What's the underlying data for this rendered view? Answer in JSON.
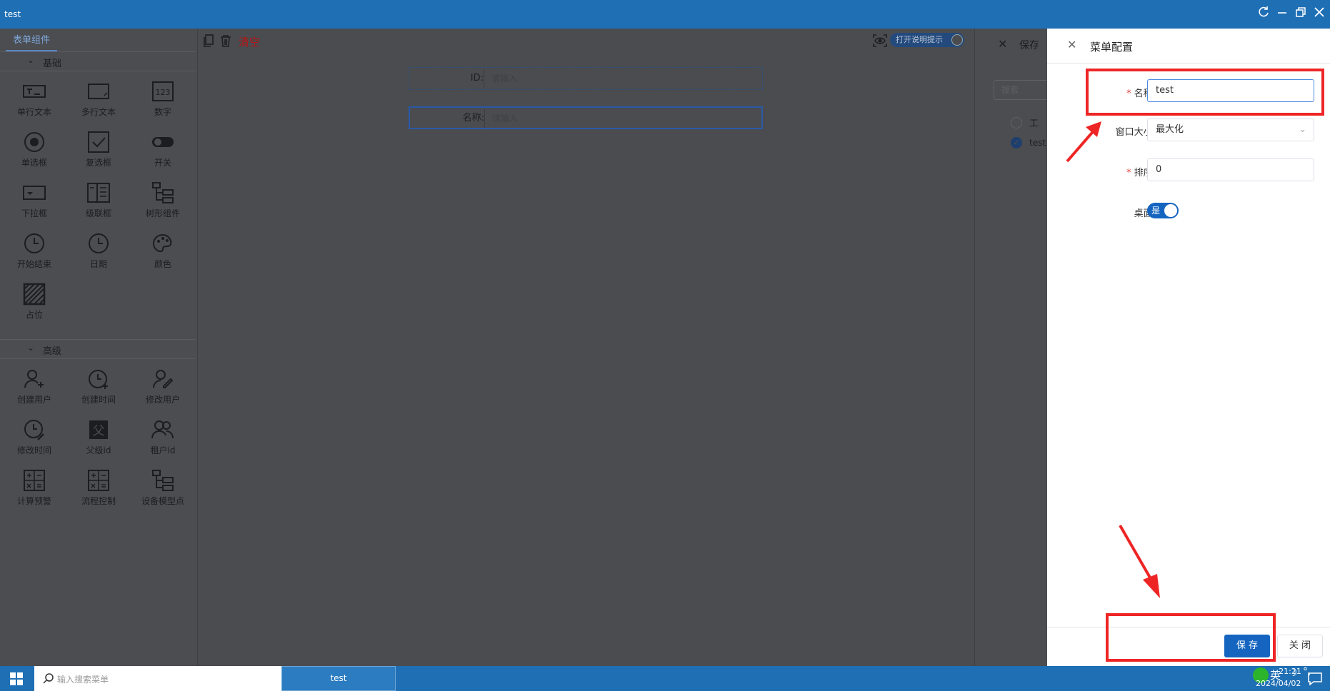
{
  "window": {
    "title": "test"
  },
  "left_panel": {
    "tab_label": "表单组件",
    "basic": {
      "header": "基础",
      "items": [
        {
          "label": "单行文本",
          "icon": "single-line-text-icon"
        },
        {
          "label": "多行文本",
          "icon": "multi-line-text-icon"
        },
        {
          "label": "数字",
          "icon": "number-icon"
        },
        {
          "label": "单选框",
          "icon": "radio-icon"
        },
        {
          "label": "复选框",
          "icon": "checkbox-icon"
        },
        {
          "label": "开关",
          "icon": "switch-icon"
        },
        {
          "label": "下拉框",
          "icon": "dropdown-icon"
        },
        {
          "label": "级联框",
          "icon": "cascader-icon"
        },
        {
          "label": "树形组件",
          "icon": "tree-icon"
        },
        {
          "label": "开始结束",
          "icon": "clock-range-icon"
        },
        {
          "label": "日期",
          "icon": "date-clock-icon"
        },
        {
          "label": "颜色",
          "icon": "palette-icon"
        },
        {
          "label": "占位",
          "icon": "placeholder-icon"
        }
      ]
    },
    "advanced": {
      "header": "高级",
      "items": [
        {
          "label": "创建用户",
          "icon": "create-user-icon"
        },
        {
          "label": "创建时间",
          "icon": "create-time-icon"
        },
        {
          "label": "修改用户",
          "icon": "edit-user-icon"
        },
        {
          "label": "修改时间",
          "icon": "edit-time-icon"
        },
        {
          "label": "父级id",
          "icon": "parent-id-icon"
        },
        {
          "label": "租户id",
          "icon": "tenant-id-icon"
        },
        {
          "label": "计算预警",
          "icon": "calculator-icon"
        },
        {
          "label": "流程控制",
          "icon": "flow-control-icon"
        },
        {
          "label": "设备模型点",
          "icon": "device-model-icon"
        }
      ]
    }
  },
  "toolbar": {
    "clear_label": "清空",
    "help_toggle_label": "打开说明提示"
  },
  "form_canvas": {
    "fields": [
      {
        "label": "ID:",
        "placeholder": "请输入"
      },
      {
        "label": "名称:",
        "placeholder": "请输入"
      }
    ]
  },
  "middle_drawer": {
    "title_partial": "保存",
    "search_placeholder": "搜索",
    "options": [
      {
        "label": "工",
        "checked": false
      },
      {
        "label": "test",
        "checked": true
      }
    ]
  },
  "menu_config": {
    "title": "菜单配置",
    "name_label": "名称:",
    "name_value": "test",
    "window_size_label": "窗口大小:",
    "window_size_value": "最大化",
    "order_label": "排序:",
    "order_value": "0",
    "desktop_label": "桌面:",
    "desktop_value": "是",
    "save_label": "保 存",
    "close_label": "关 闭"
  },
  "taskbar": {
    "search_placeholder": "输入搜索菜单",
    "task_label": "test",
    "ime_label": "英",
    "time": "21:21",
    "date": "2024/04/02"
  },
  "colors": {
    "accent": "#1f6fb5",
    "annotation": "#ee2525",
    "danger": "#b31515"
  }
}
